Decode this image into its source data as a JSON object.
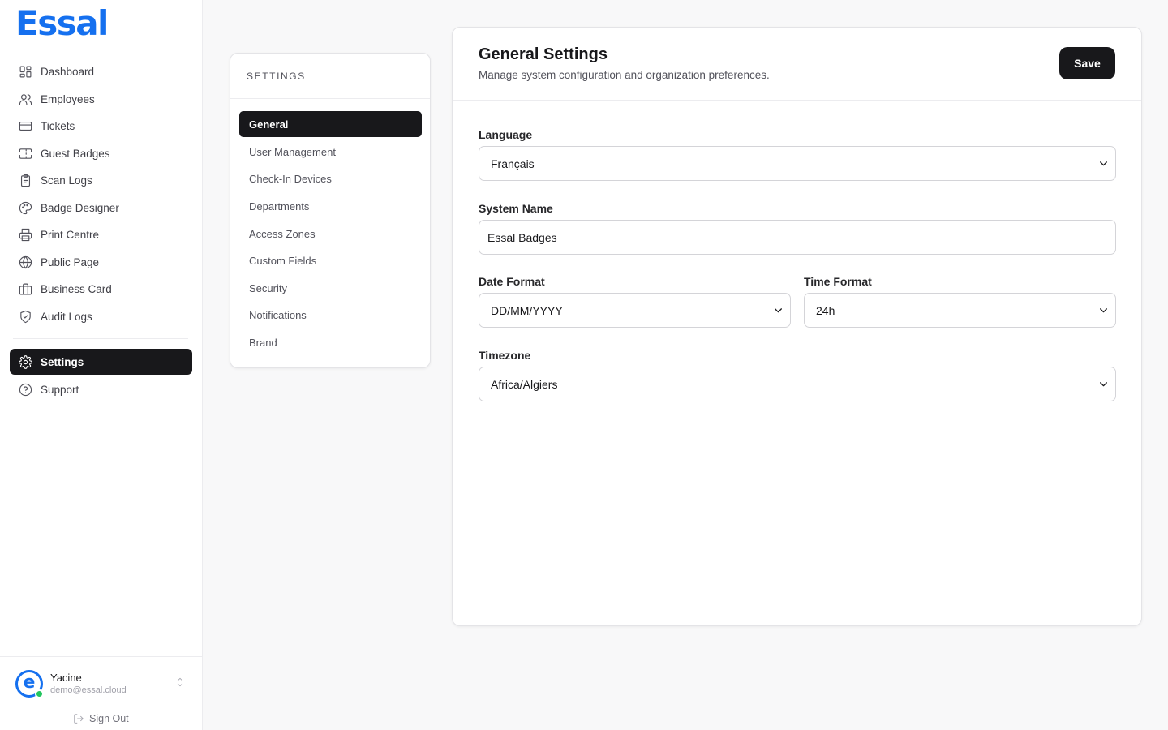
{
  "app": {
    "logo": "Essal"
  },
  "sidebar": {
    "items": [
      {
        "label": "Dashboard",
        "icon": "dashboard-icon"
      },
      {
        "label": "Employees",
        "icon": "users-icon"
      },
      {
        "label": "Tickets",
        "icon": "ticket-icon"
      },
      {
        "label": "Guest Badges",
        "icon": "badge-icon"
      },
      {
        "label": "Scan Logs",
        "icon": "clipboard-icon"
      },
      {
        "label": "Badge Designer",
        "icon": "palette-icon"
      },
      {
        "label": "Print Centre",
        "icon": "printer-icon"
      },
      {
        "label": "Public Page",
        "icon": "globe-icon"
      },
      {
        "label": "Business Card",
        "icon": "briefcase-icon"
      },
      {
        "label": "Audit Logs",
        "icon": "shield-check-icon"
      }
    ],
    "bottom_items": [
      {
        "label": "Settings",
        "icon": "gear-icon",
        "active": true
      },
      {
        "label": "Support",
        "icon": "help-circle-icon"
      }
    ],
    "user": {
      "avatar_letter": "e",
      "name": "Yacine",
      "email": "demo@essal.cloud",
      "status_color": "#22c55e"
    },
    "signout_label": "Sign Out"
  },
  "settings_nav": {
    "heading": "SETTINGS",
    "items": [
      "General",
      "User Management",
      "Check-In Devices",
      "Departments",
      "Access Zones",
      "Custom Fields",
      "Security",
      "Notifications",
      "Brand"
    ],
    "active": "General"
  },
  "main": {
    "title": "General Settings",
    "subtitle": "Manage system configuration and organization preferences.",
    "save_label": "Save",
    "fields": {
      "language": {
        "label": "Language",
        "value": "Français"
      },
      "system_name": {
        "label": "System Name",
        "value": "Essal Badges"
      },
      "date_format": {
        "label": "Date Format",
        "value": "DD/MM/YYYY"
      },
      "time_format": {
        "label": "Time Format",
        "value": "24h"
      },
      "timezone": {
        "label": "Timezone",
        "value": "Africa/Algiers"
      }
    }
  },
  "colors": {
    "brand": "#1570ef",
    "active_bg": "#18181b"
  }
}
